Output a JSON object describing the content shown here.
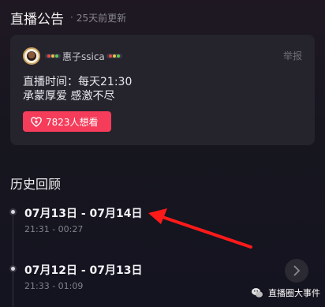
{
  "announcement": {
    "title": "直播公告",
    "separator": "·",
    "updated": "25天前更新"
  },
  "card": {
    "username": "惠子ssica",
    "report_label": "举报",
    "line1": "直播时间：每天21:30",
    "line2": "承蒙厚爱 感激不尽",
    "want_button": "7823人想看"
  },
  "history": {
    "title": "历史回顾",
    "items": [
      {
        "range": "07月13日 - 07月14日",
        "time": "21:31 - 00:27"
      },
      {
        "range": "07月12日 - 07月13日",
        "time": "21:33 - 01:09"
      }
    ]
  },
  "watermark": {
    "text": "直播圈大事件"
  },
  "colors": {
    "accent": "#f53c5a",
    "annotation_arrow": "#ff1a1a",
    "background": "#161620",
    "card": "#25232c"
  },
  "icons": {
    "heart": "heart-plus-icon",
    "chevron": "chevron-right-icon",
    "avatar": "avatar",
    "wechat": "wechat-icon"
  }
}
